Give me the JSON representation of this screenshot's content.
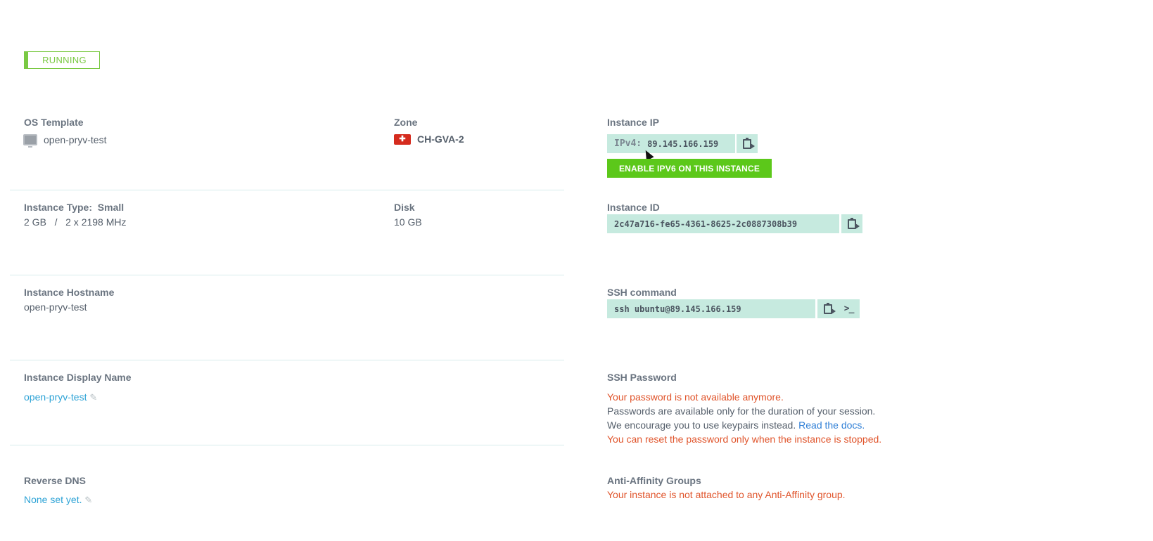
{
  "status": {
    "label": "RUNNING"
  },
  "os_template": {
    "label": "OS Template",
    "value": "open-pryv-test",
    "icon": "monitor-icon"
  },
  "zone": {
    "label": "Zone",
    "value": "CH-GVA-2",
    "flag_glyph": "✚"
  },
  "instance_ip": {
    "label": "Instance IP",
    "prefix": "IPv4:",
    "value": "89.145.166.159",
    "enable_ipv6_label": "ENABLE IPV6 ON THIS INSTANCE"
  },
  "instance_type": {
    "label": "Instance Type:",
    "type": "Small",
    "value": "2 GB   /   2 x 2198 MHz"
  },
  "disk": {
    "label": "Disk",
    "value": "10 GB"
  },
  "instance_id": {
    "label": "Instance ID",
    "value": "2c47a716-fe65-4361-8625-2c0887308b39"
  },
  "hostname": {
    "label": "Instance Hostname",
    "value": "open-pryv-test"
  },
  "ssh_command": {
    "label": "SSH command",
    "value": "ssh ubuntu@89.145.166.159",
    "terminal_glyph": ">_"
  },
  "display_name": {
    "label": "Instance Display Name",
    "value": "open-pryv-test",
    "edit_glyph": "✎"
  },
  "ssh_password": {
    "label": "SSH Password",
    "unavailable": "Your password is not available anymore.",
    "session_note": "Passwords are available only for the duration of your session.",
    "keypairs_note": "We encourage you to use keypairs instead.",
    "docs_link": "Read the docs.",
    "reset_note": "You can reset the password only when the instance is stopped."
  },
  "reverse_dns": {
    "label": "Reverse DNS",
    "value": "None set yet.",
    "edit_glyph": "✎"
  },
  "anti_affinity": {
    "label": "Anti-Affinity Groups",
    "value": "Your instance is not attached to any Anti-Affinity group."
  },
  "colors": {
    "running_green": "#7ac943",
    "button_green": "#5cc81a",
    "mono_box_bg": "#c6eadf",
    "warning_red": "#e0542b",
    "link_blue": "#2ea3d6"
  }
}
